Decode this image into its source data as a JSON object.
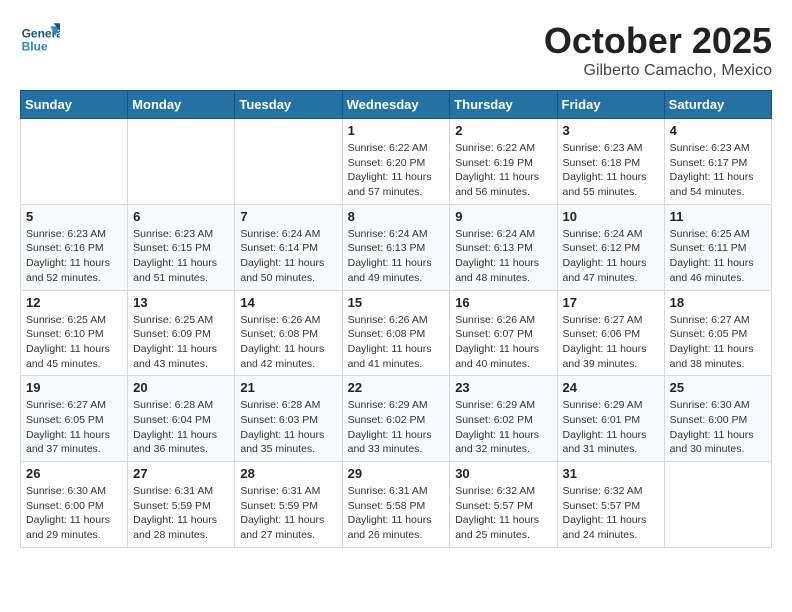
{
  "header": {
    "logo_line1": "General",
    "logo_line2": "Blue",
    "month": "October 2025",
    "location": "Gilberto Camacho, Mexico"
  },
  "days_of_week": [
    "Sunday",
    "Monday",
    "Tuesday",
    "Wednesday",
    "Thursday",
    "Friday",
    "Saturday"
  ],
  "weeks": [
    [
      {
        "day": "",
        "info": ""
      },
      {
        "day": "",
        "info": ""
      },
      {
        "day": "",
        "info": ""
      },
      {
        "day": "1",
        "info": "Sunrise: 6:22 AM\nSunset: 6:20 PM\nDaylight: 11 hours and 57 minutes."
      },
      {
        "day": "2",
        "info": "Sunrise: 6:22 AM\nSunset: 6:19 PM\nDaylight: 11 hours and 56 minutes."
      },
      {
        "day": "3",
        "info": "Sunrise: 6:23 AM\nSunset: 6:18 PM\nDaylight: 11 hours and 55 minutes."
      },
      {
        "day": "4",
        "info": "Sunrise: 6:23 AM\nSunset: 6:17 PM\nDaylight: 11 hours and 54 minutes."
      }
    ],
    [
      {
        "day": "5",
        "info": "Sunrise: 6:23 AM\nSunset: 6:16 PM\nDaylight: 11 hours and 52 minutes."
      },
      {
        "day": "6",
        "info": "Sunrise: 6:23 AM\nSunset: 6:15 PM\nDaylight: 11 hours and 51 minutes."
      },
      {
        "day": "7",
        "info": "Sunrise: 6:24 AM\nSunset: 6:14 PM\nDaylight: 11 hours and 50 minutes."
      },
      {
        "day": "8",
        "info": "Sunrise: 6:24 AM\nSunset: 6:13 PM\nDaylight: 11 hours and 49 minutes."
      },
      {
        "day": "9",
        "info": "Sunrise: 6:24 AM\nSunset: 6:13 PM\nDaylight: 11 hours and 48 minutes."
      },
      {
        "day": "10",
        "info": "Sunrise: 6:24 AM\nSunset: 6:12 PM\nDaylight: 11 hours and 47 minutes."
      },
      {
        "day": "11",
        "info": "Sunrise: 6:25 AM\nSunset: 6:11 PM\nDaylight: 11 hours and 46 minutes."
      }
    ],
    [
      {
        "day": "12",
        "info": "Sunrise: 6:25 AM\nSunset: 6:10 PM\nDaylight: 11 hours and 45 minutes."
      },
      {
        "day": "13",
        "info": "Sunrise: 6:25 AM\nSunset: 6:09 PM\nDaylight: 11 hours and 43 minutes."
      },
      {
        "day": "14",
        "info": "Sunrise: 6:26 AM\nSunset: 6:08 PM\nDaylight: 11 hours and 42 minutes."
      },
      {
        "day": "15",
        "info": "Sunrise: 6:26 AM\nSunset: 6:08 PM\nDaylight: 11 hours and 41 minutes."
      },
      {
        "day": "16",
        "info": "Sunrise: 6:26 AM\nSunset: 6:07 PM\nDaylight: 11 hours and 40 minutes."
      },
      {
        "day": "17",
        "info": "Sunrise: 6:27 AM\nSunset: 6:06 PM\nDaylight: 11 hours and 39 minutes."
      },
      {
        "day": "18",
        "info": "Sunrise: 6:27 AM\nSunset: 6:05 PM\nDaylight: 11 hours and 38 minutes."
      }
    ],
    [
      {
        "day": "19",
        "info": "Sunrise: 6:27 AM\nSunset: 6:05 PM\nDaylight: 11 hours and 37 minutes."
      },
      {
        "day": "20",
        "info": "Sunrise: 6:28 AM\nSunset: 6:04 PM\nDaylight: 11 hours and 36 minutes."
      },
      {
        "day": "21",
        "info": "Sunrise: 6:28 AM\nSunset: 6:03 PM\nDaylight: 11 hours and 35 minutes."
      },
      {
        "day": "22",
        "info": "Sunrise: 6:29 AM\nSunset: 6:02 PM\nDaylight: 11 hours and 33 minutes."
      },
      {
        "day": "23",
        "info": "Sunrise: 6:29 AM\nSunset: 6:02 PM\nDaylight: 11 hours and 32 minutes."
      },
      {
        "day": "24",
        "info": "Sunrise: 6:29 AM\nSunset: 6:01 PM\nDaylight: 11 hours and 31 minutes."
      },
      {
        "day": "25",
        "info": "Sunrise: 6:30 AM\nSunset: 6:00 PM\nDaylight: 11 hours and 30 minutes."
      }
    ],
    [
      {
        "day": "26",
        "info": "Sunrise: 6:30 AM\nSunset: 6:00 PM\nDaylight: 11 hours and 29 minutes."
      },
      {
        "day": "27",
        "info": "Sunrise: 6:31 AM\nSunset: 5:59 PM\nDaylight: 11 hours and 28 minutes."
      },
      {
        "day": "28",
        "info": "Sunrise: 6:31 AM\nSunset: 5:59 PM\nDaylight: 11 hours and 27 minutes."
      },
      {
        "day": "29",
        "info": "Sunrise: 6:31 AM\nSunset: 5:58 PM\nDaylight: 11 hours and 26 minutes."
      },
      {
        "day": "30",
        "info": "Sunrise: 6:32 AM\nSunset: 5:57 PM\nDaylight: 11 hours and 25 minutes."
      },
      {
        "day": "31",
        "info": "Sunrise: 6:32 AM\nSunset: 5:57 PM\nDaylight: 11 hours and 24 minutes."
      },
      {
        "day": "",
        "info": ""
      }
    ]
  ]
}
